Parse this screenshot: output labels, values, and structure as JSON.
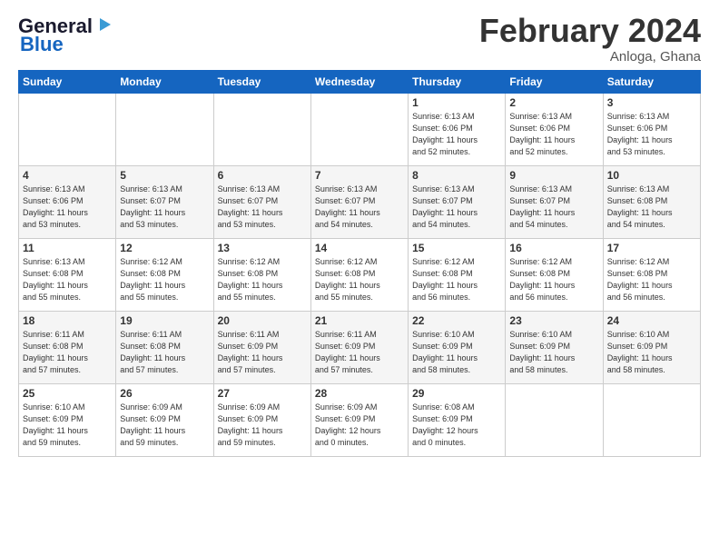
{
  "logo": {
    "line1": "General",
    "line2": "Blue"
  },
  "title": "February 2024",
  "location": "Anloga, Ghana",
  "days_header": [
    "Sunday",
    "Monday",
    "Tuesday",
    "Wednesday",
    "Thursday",
    "Friday",
    "Saturday"
  ],
  "weeks": [
    [
      {
        "num": "",
        "info": ""
      },
      {
        "num": "",
        "info": ""
      },
      {
        "num": "",
        "info": ""
      },
      {
        "num": "",
        "info": ""
      },
      {
        "num": "1",
        "info": "Sunrise: 6:13 AM\nSunset: 6:06 PM\nDaylight: 11 hours\nand 52 minutes."
      },
      {
        "num": "2",
        "info": "Sunrise: 6:13 AM\nSunset: 6:06 PM\nDaylight: 11 hours\nand 52 minutes."
      },
      {
        "num": "3",
        "info": "Sunrise: 6:13 AM\nSunset: 6:06 PM\nDaylight: 11 hours\nand 53 minutes."
      }
    ],
    [
      {
        "num": "4",
        "info": "Sunrise: 6:13 AM\nSunset: 6:06 PM\nDaylight: 11 hours\nand 53 minutes."
      },
      {
        "num": "5",
        "info": "Sunrise: 6:13 AM\nSunset: 6:07 PM\nDaylight: 11 hours\nand 53 minutes."
      },
      {
        "num": "6",
        "info": "Sunrise: 6:13 AM\nSunset: 6:07 PM\nDaylight: 11 hours\nand 53 minutes."
      },
      {
        "num": "7",
        "info": "Sunrise: 6:13 AM\nSunset: 6:07 PM\nDaylight: 11 hours\nand 54 minutes."
      },
      {
        "num": "8",
        "info": "Sunrise: 6:13 AM\nSunset: 6:07 PM\nDaylight: 11 hours\nand 54 minutes."
      },
      {
        "num": "9",
        "info": "Sunrise: 6:13 AM\nSunset: 6:07 PM\nDaylight: 11 hours\nand 54 minutes."
      },
      {
        "num": "10",
        "info": "Sunrise: 6:13 AM\nSunset: 6:08 PM\nDaylight: 11 hours\nand 54 minutes."
      }
    ],
    [
      {
        "num": "11",
        "info": "Sunrise: 6:13 AM\nSunset: 6:08 PM\nDaylight: 11 hours\nand 55 minutes."
      },
      {
        "num": "12",
        "info": "Sunrise: 6:12 AM\nSunset: 6:08 PM\nDaylight: 11 hours\nand 55 minutes."
      },
      {
        "num": "13",
        "info": "Sunrise: 6:12 AM\nSunset: 6:08 PM\nDaylight: 11 hours\nand 55 minutes."
      },
      {
        "num": "14",
        "info": "Sunrise: 6:12 AM\nSunset: 6:08 PM\nDaylight: 11 hours\nand 55 minutes."
      },
      {
        "num": "15",
        "info": "Sunrise: 6:12 AM\nSunset: 6:08 PM\nDaylight: 11 hours\nand 56 minutes."
      },
      {
        "num": "16",
        "info": "Sunrise: 6:12 AM\nSunset: 6:08 PM\nDaylight: 11 hours\nand 56 minutes."
      },
      {
        "num": "17",
        "info": "Sunrise: 6:12 AM\nSunset: 6:08 PM\nDaylight: 11 hours\nand 56 minutes."
      }
    ],
    [
      {
        "num": "18",
        "info": "Sunrise: 6:11 AM\nSunset: 6:08 PM\nDaylight: 11 hours\nand 57 minutes."
      },
      {
        "num": "19",
        "info": "Sunrise: 6:11 AM\nSunset: 6:08 PM\nDaylight: 11 hours\nand 57 minutes."
      },
      {
        "num": "20",
        "info": "Sunrise: 6:11 AM\nSunset: 6:09 PM\nDaylight: 11 hours\nand 57 minutes."
      },
      {
        "num": "21",
        "info": "Sunrise: 6:11 AM\nSunset: 6:09 PM\nDaylight: 11 hours\nand 57 minutes."
      },
      {
        "num": "22",
        "info": "Sunrise: 6:10 AM\nSunset: 6:09 PM\nDaylight: 11 hours\nand 58 minutes."
      },
      {
        "num": "23",
        "info": "Sunrise: 6:10 AM\nSunset: 6:09 PM\nDaylight: 11 hours\nand 58 minutes."
      },
      {
        "num": "24",
        "info": "Sunrise: 6:10 AM\nSunset: 6:09 PM\nDaylight: 11 hours\nand 58 minutes."
      }
    ],
    [
      {
        "num": "25",
        "info": "Sunrise: 6:10 AM\nSunset: 6:09 PM\nDaylight: 11 hours\nand 59 minutes."
      },
      {
        "num": "26",
        "info": "Sunrise: 6:09 AM\nSunset: 6:09 PM\nDaylight: 11 hours\nand 59 minutes."
      },
      {
        "num": "27",
        "info": "Sunrise: 6:09 AM\nSunset: 6:09 PM\nDaylight: 11 hours\nand 59 minutes."
      },
      {
        "num": "28",
        "info": "Sunrise: 6:09 AM\nSunset: 6:09 PM\nDaylight: 12 hours\nand 0 minutes."
      },
      {
        "num": "29",
        "info": "Sunrise: 6:08 AM\nSunset: 6:09 PM\nDaylight: 12 hours\nand 0 minutes."
      },
      {
        "num": "",
        "info": ""
      },
      {
        "num": "",
        "info": ""
      }
    ]
  ]
}
